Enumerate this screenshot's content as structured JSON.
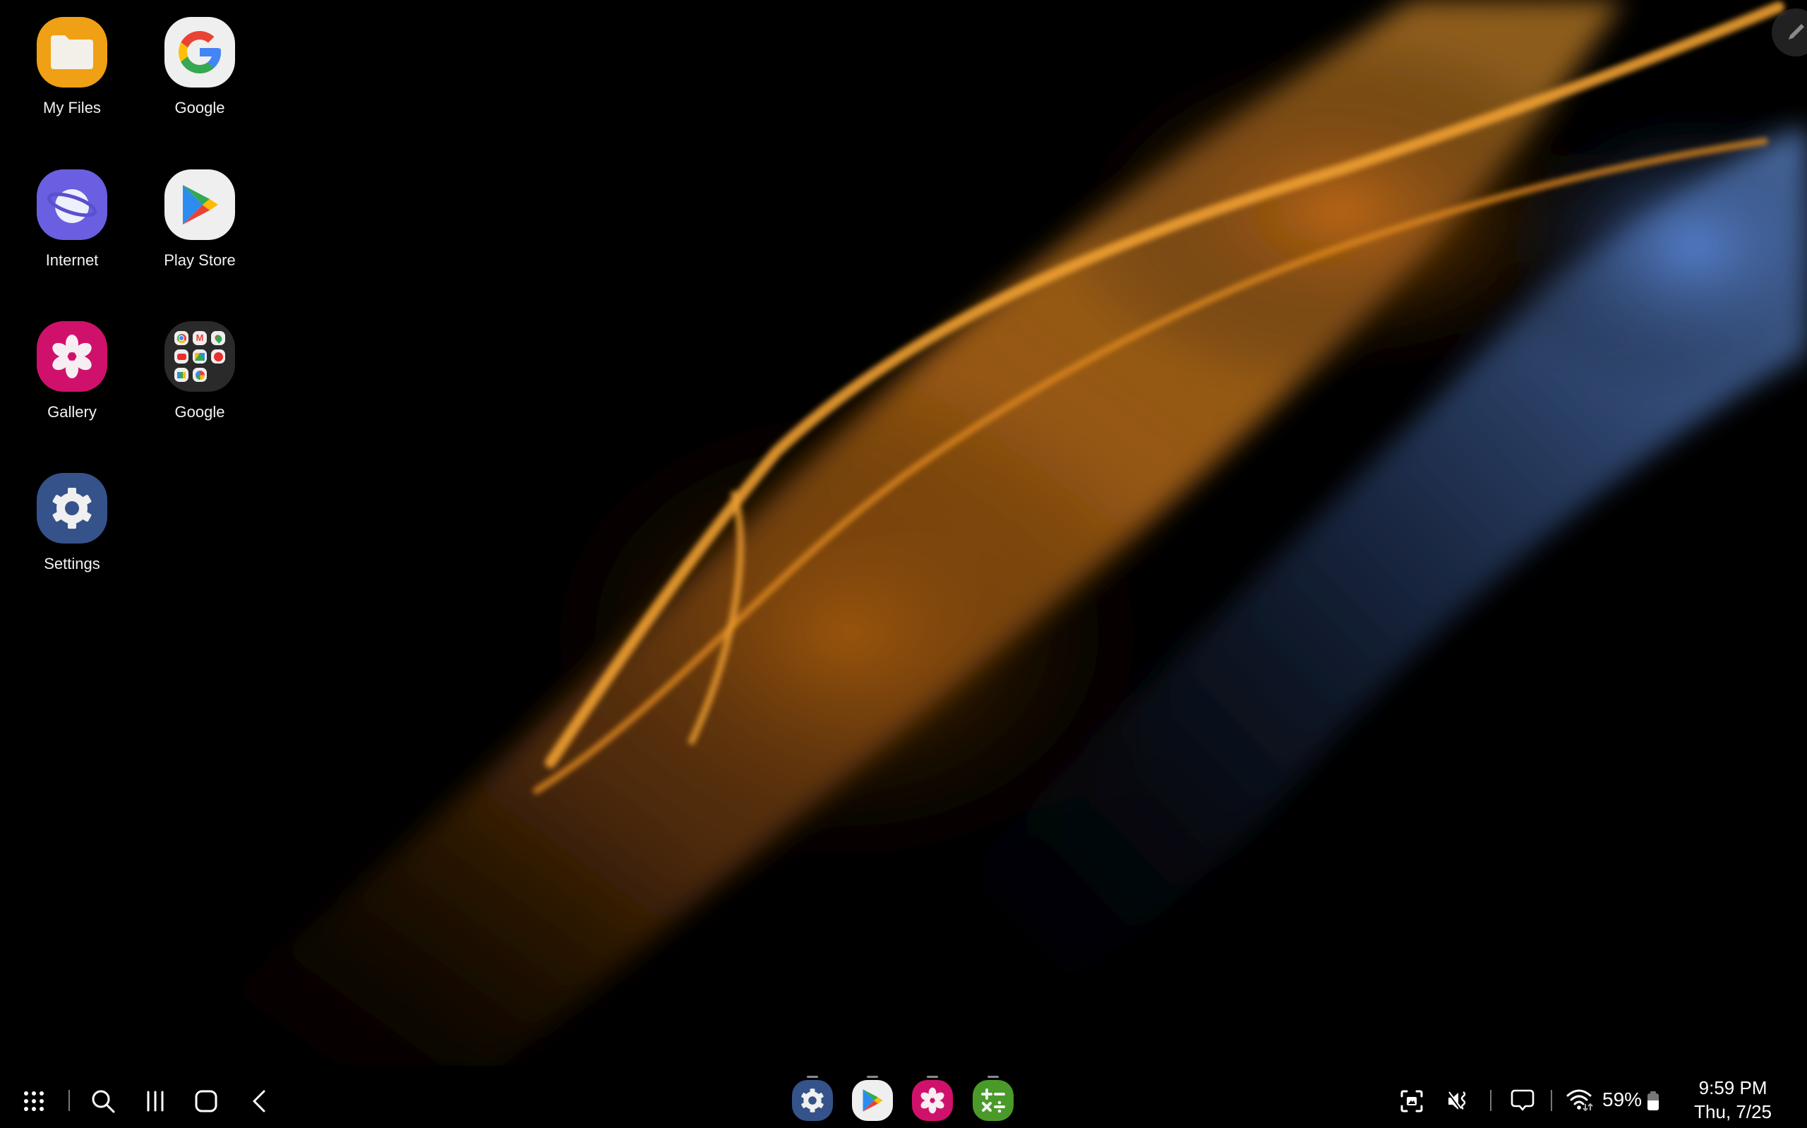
{
  "desktop": {
    "apps": [
      {
        "label": "My Files",
        "icon": "folder-icon",
        "color": "#F0A014"
      },
      {
        "label": "Google",
        "icon": "google-g-icon",
        "color": "#EFEFEF"
      },
      {
        "label": "Internet",
        "icon": "planet-icon",
        "color": "#6A5FE0"
      },
      {
        "label": "Play Store",
        "icon": "play-store-icon",
        "color": "#EFEFEF"
      },
      {
        "label": "Gallery",
        "icon": "flower-icon",
        "color": "#D0116C"
      },
      {
        "label": "Google",
        "icon": "folder-google-apps-icon",
        "color": "#2A2A2A"
      },
      {
        "label": "Settings",
        "icon": "gear-icon",
        "color": "#35538A"
      }
    ]
  },
  "spen": {
    "icon": "pen-icon"
  },
  "taskbar": {
    "left": [
      {
        "name": "apps-grid-icon"
      },
      {
        "name": "search-icon"
      },
      {
        "name": "recents-icon"
      },
      {
        "name": "home-icon"
      },
      {
        "name": "back-icon"
      }
    ],
    "dock": [
      {
        "name": "Settings",
        "icon": "gear-icon",
        "color": "#35538A"
      },
      {
        "name": "Play Store",
        "icon": "play-store-icon",
        "color": "#EFEFEF"
      },
      {
        "name": "Gallery",
        "icon": "flower-icon",
        "color": "#D0116C"
      },
      {
        "name": "Calculator",
        "icon": "calculator-icon",
        "color": "#4A9A2A"
      }
    ],
    "status": {
      "battery_percent_label": "59%",
      "battery_level": 0.59,
      "time": "9:59 PM",
      "date": "Thu, 7/25"
    }
  }
}
